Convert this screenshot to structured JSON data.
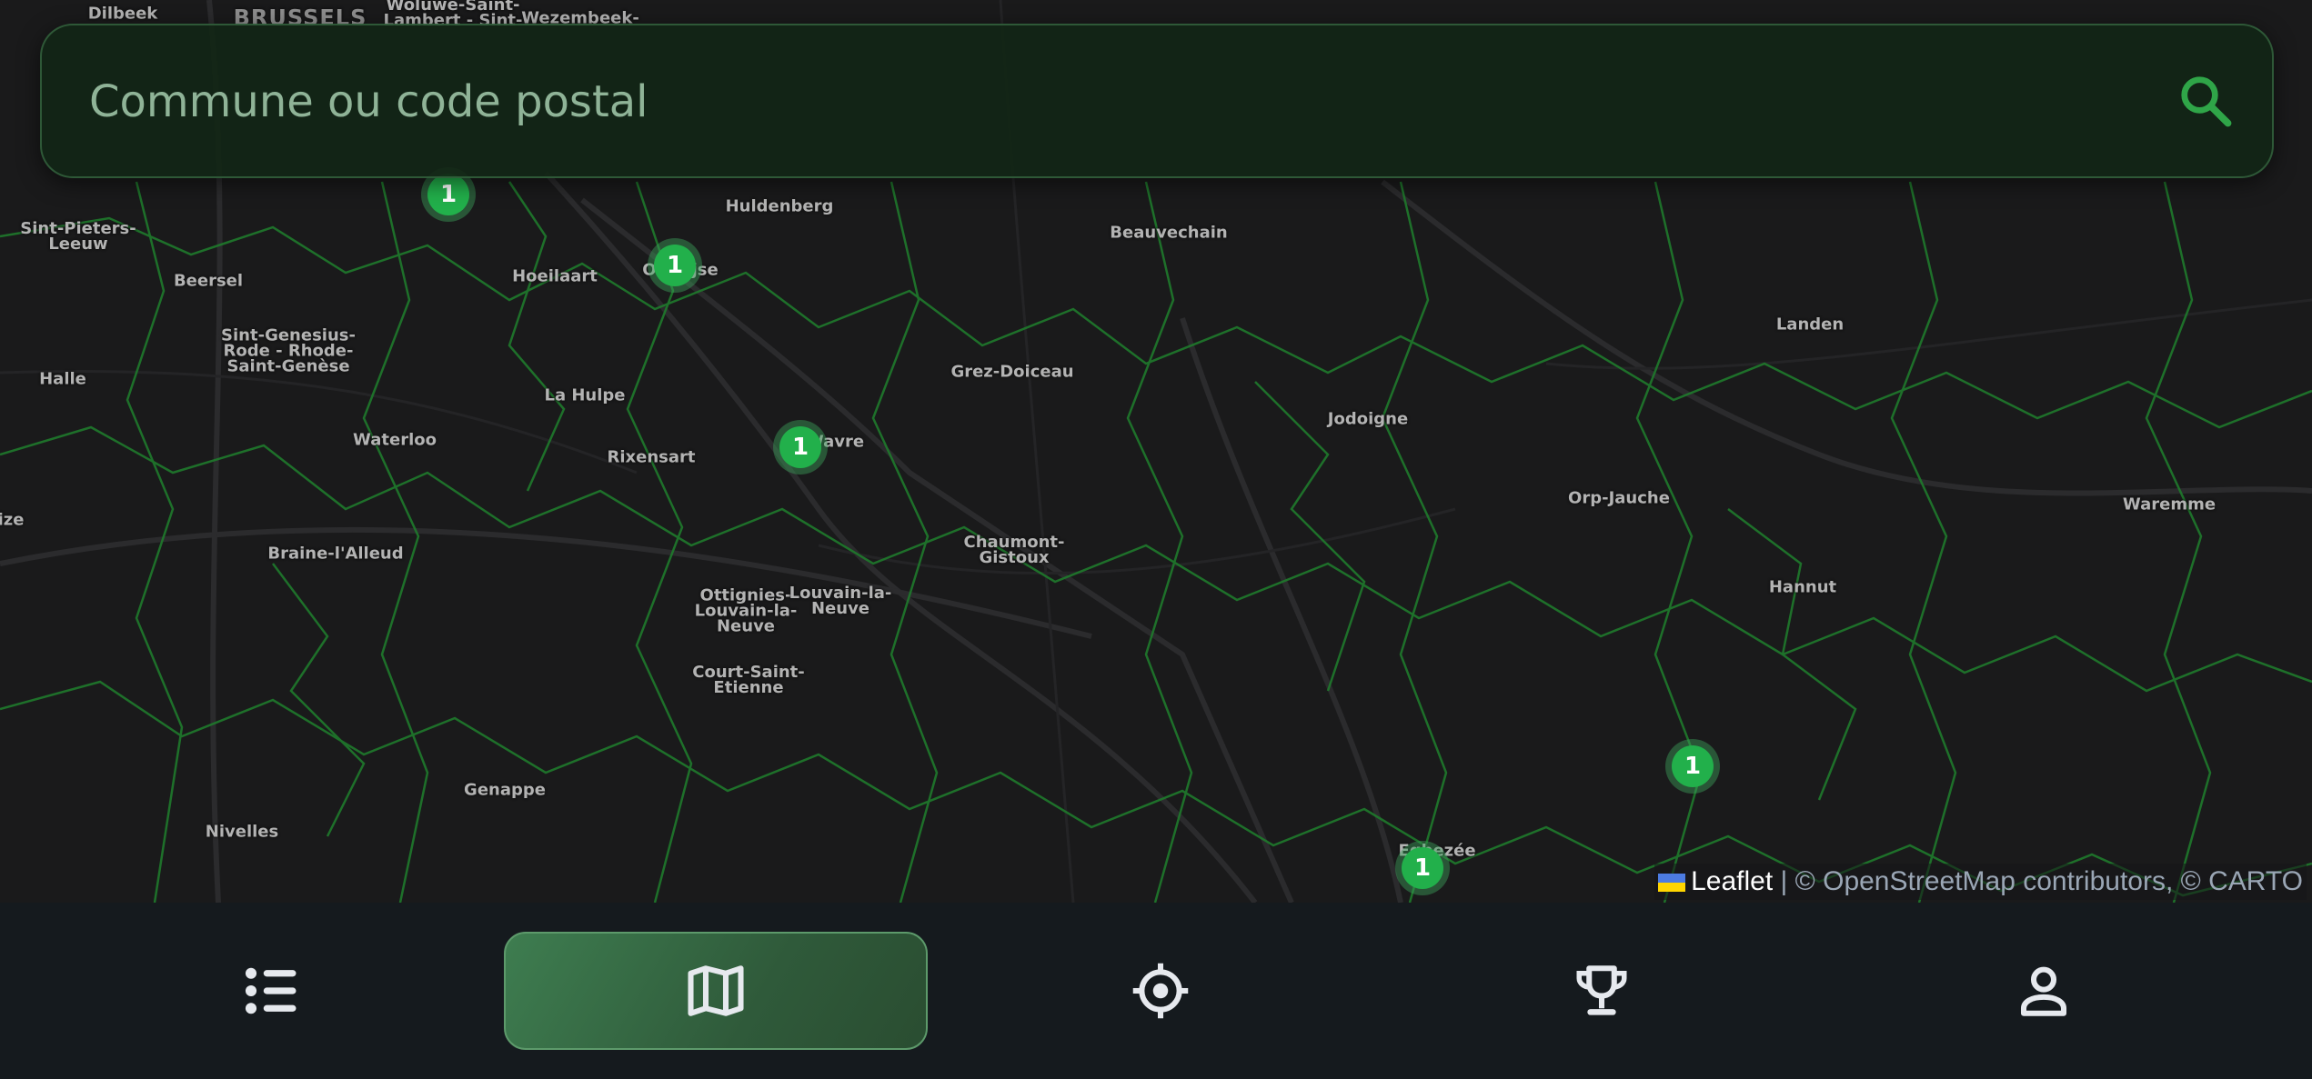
{
  "search": {
    "placeholder": "Commune ou code postal",
    "value": "",
    "icon": "search-icon"
  },
  "map": {
    "places": [
      {
        "name": "Dilbeek"
      },
      {
        "name": "BRUSSELS"
      },
      {
        "name": "Woluwe-Saint-\nLambert - Sint-"
      },
      {
        "name": "Wezembeek-"
      },
      {
        "name": "Sint-Pieters-\nLeeuw"
      },
      {
        "name": "Beersel"
      },
      {
        "name": "Hoeilaart"
      },
      {
        "name": "Huldenberg"
      },
      {
        "name": "Beauvechain"
      },
      {
        "name": "Sint-Genesius-\nRode - Rhode-\nSaint-Genèse"
      },
      {
        "name": "Halle"
      },
      {
        "name": "La Hulpe"
      },
      {
        "name": "Grez-Doiceau"
      },
      {
        "name": "Jodoigne"
      },
      {
        "name": "Landen"
      },
      {
        "name": "Waterloo"
      },
      {
        "name": "Rixensart"
      },
      {
        "name": "Wavre"
      },
      {
        "name": "Orp-Jauche"
      },
      {
        "name": "Waremme"
      },
      {
        "name": "ize"
      },
      {
        "name": "Braine-l'Alleud"
      },
      {
        "name": "Chaumont-\nGistoux"
      },
      {
        "name": "Hannut"
      },
      {
        "name": "Ottignies-\nLouvain-la-\nNeuve"
      },
      {
        "name": "Louvain-la-\nNeuve"
      },
      {
        "name": "Court-Saint-\nEtienne"
      },
      {
        "name": "Genappe"
      },
      {
        "name": "Nivelles"
      },
      {
        "name": "Eghezée"
      },
      {
        "name": "Overijse"
      }
    ],
    "clusters": [
      {
        "count": "1"
      },
      {
        "count": "1"
      },
      {
        "count": "1"
      },
      {
        "count": "1"
      },
      {
        "count": "1"
      }
    ],
    "colors": {
      "boundary": "#1f7a2c",
      "cluster": "#22b04b",
      "background": "#1a1a1b"
    }
  },
  "attribution": {
    "leaflet": "Leaflet",
    "rest": " | © OpenStreetMap contributors, © CARTO"
  },
  "nav": {
    "items": [
      {
        "name": "list",
        "icon": "list-icon",
        "active": false
      },
      {
        "name": "map",
        "icon": "map-icon",
        "active": true
      },
      {
        "name": "locate",
        "icon": "target-icon",
        "active": false
      },
      {
        "name": "ranking",
        "icon": "trophy-icon",
        "active": false
      },
      {
        "name": "profile",
        "icon": "user-icon",
        "active": false
      }
    ],
    "colors": {
      "active_bg": "#3e7d50",
      "icon": "#e6e9ee"
    }
  }
}
